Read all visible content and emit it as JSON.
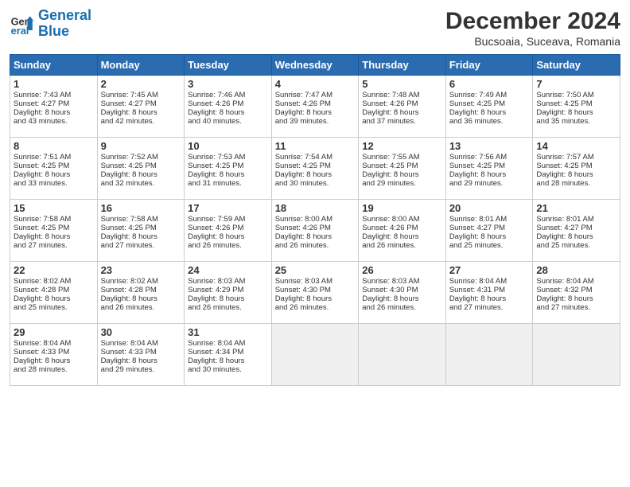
{
  "header": {
    "logo_line1": "General",
    "logo_line2": "Blue",
    "month": "December 2024",
    "location": "Bucsoaia, Suceava, Romania"
  },
  "days_of_week": [
    "Sunday",
    "Monday",
    "Tuesday",
    "Wednesday",
    "Thursday",
    "Friday",
    "Saturday"
  ],
  "weeks": [
    [
      {
        "num": "1",
        "lines": [
          "Sunrise: 7:43 AM",
          "Sunset: 4:27 PM",
          "Daylight: 8 hours",
          "and 43 minutes."
        ]
      },
      {
        "num": "2",
        "lines": [
          "Sunrise: 7:45 AM",
          "Sunset: 4:27 PM",
          "Daylight: 8 hours",
          "and 42 minutes."
        ]
      },
      {
        "num": "3",
        "lines": [
          "Sunrise: 7:46 AM",
          "Sunset: 4:26 PM",
          "Daylight: 8 hours",
          "and 40 minutes."
        ]
      },
      {
        "num": "4",
        "lines": [
          "Sunrise: 7:47 AM",
          "Sunset: 4:26 PM",
          "Daylight: 8 hours",
          "and 39 minutes."
        ]
      },
      {
        "num": "5",
        "lines": [
          "Sunrise: 7:48 AM",
          "Sunset: 4:26 PM",
          "Daylight: 8 hours",
          "and 37 minutes."
        ]
      },
      {
        "num": "6",
        "lines": [
          "Sunrise: 7:49 AM",
          "Sunset: 4:25 PM",
          "Daylight: 8 hours",
          "and 36 minutes."
        ]
      },
      {
        "num": "7",
        "lines": [
          "Sunrise: 7:50 AM",
          "Sunset: 4:25 PM",
          "Daylight: 8 hours",
          "and 35 minutes."
        ]
      }
    ],
    [
      {
        "num": "8",
        "lines": [
          "Sunrise: 7:51 AM",
          "Sunset: 4:25 PM",
          "Daylight: 8 hours",
          "and 33 minutes."
        ]
      },
      {
        "num": "9",
        "lines": [
          "Sunrise: 7:52 AM",
          "Sunset: 4:25 PM",
          "Daylight: 8 hours",
          "and 32 minutes."
        ]
      },
      {
        "num": "10",
        "lines": [
          "Sunrise: 7:53 AM",
          "Sunset: 4:25 PM",
          "Daylight: 8 hours",
          "and 31 minutes."
        ]
      },
      {
        "num": "11",
        "lines": [
          "Sunrise: 7:54 AM",
          "Sunset: 4:25 PM",
          "Daylight: 8 hours",
          "and 30 minutes."
        ]
      },
      {
        "num": "12",
        "lines": [
          "Sunrise: 7:55 AM",
          "Sunset: 4:25 PM",
          "Daylight: 8 hours",
          "and 29 minutes."
        ]
      },
      {
        "num": "13",
        "lines": [
          "Sunrise: 7:56 AM",
          "Sunset: 4:25 PM",
          "Daylight: 8 hours",
          "and 29 minutes."
        ]
      },
      {
        "num": "14",
        "lines": [
          "Sunrise: 7:57 AM",
          "Sunset: 4:25 PM",
          "Daylight: 8 hours",
          "and 28 minutes."
        ]
      }
    ],
    [
      {
        "num": "15",
        "lines": [
          "Sunrise: 7:58 AM",
          "Sunset: 4:25 PM",
          "Daylight: 8 hours",
          "and 27 minutes."
        ]
      },
      {
        "num": "16",
        "lines": [
          "Sunrise: 7:58 AM",
          "Sunset: 4:25 PM",
          "Daylight: 8 hours",
          "and 27 minutes."
        ]
      },
      {
        "num": "17",
        "lines": [
          "Sunrise: 7:59 AM",
          "Sunset: 4:26 PM",
          "Daylight: 8 hours",
          "and 26 minutes."
        ]
      },
      {
        "num": "18",
        "lines": [
          "Sunrise: 8:00 AM",
          "Sunset: 4:26 PM",
          "Daylight: 8 hours",
          "and 26 minutes."
        ]
      },
      {
        "num": "19",
        "lines": [
          "Sunrise: 8:00 AM",
          "Sunset: 4:26 PM",
          "Daylight: 8 hours",
          "and 26 minutes."
        ]
      },
      {
        "num": "20",
        "lines": [
          "Sunrise: 8:01 AM",
          "Sunset: 4:27 PM",
          "Daylight: 8 hours",
          "and 25 minutes."
        ]
      },
      {
        "num": "21",
        "lines": [
          "Sunrise: 8:01 AM",
          "Sunset: 4:27 PM",
          "Daylight: 8 hours",
          "and 25 minutes."
        ]
      }
    ],
    [
      {
        "num": "22",
        "lines": [
          "Sunrise: 8:02 AM",
          "Sunset: 4:28 PM",
          "Daylight: 8 hours",
          "and 25 minutes."
        ]
      },
      {
        "num": "23",
        "lines": [
          "Sunrise: 8:02 AM",
          "Sunset: 4:28 PM",
          "Daylight: 8 hours",
          "and 26 minutes."
        ]
      },
      {
        "num": "24",
        "lines": [
          "Sunrise: 8:03 AM",
          "Sunset: 4:29 PM",
          "Daylight: 8 hours",
          "and 26 minutes."
        ]
      },
      {
        "num": "25",
        "lines": [
          "Sunrise: 8:03 AM",
          "Sunset: 4:30 PM",
          "Daylight: 8 hours",
          "and 26 minutes."
        ]
      },
      {
        "num": "26",
        "lines": [
          "Sunrise: 8:03 AM",
          "Sunset: 4:30 PM",
          "Daylight: 8 hours",
          "and 26 minutes."
        ]
      },
      {
        "num": "27",
        "lines": [
          "Sunrise: 8:04 AM",
          "Sunset: 4:31 PM",
          "Daylight: 8 hours",
          "and 27 minutes."
        ]
      },
      {
        "num": "28",
        "lines": [
          "Sunrise: 8:04 AM",
          "Sunset: 4:32 PM",
          "Daylight: 8 hours",
          "and 27 minutes."
        ]
      }
    ],
    [
      {
        "num": "29",
        "lines": [
          "Sunrise: 8:04 AM",
          "Sunset: 4:33 PM",
          "Daylight: 8 hours",
          "and 28 minutes."
        ]
      },
      {
        "num": "30",
        "lines": [
          "Sunrise: 8:04 AM",
          "Sunset: 4:33 PM",
          "Daylight: 8 hours",
          "and 29 minutes."
        ]
      },
      {
        "num": "31",
        "lines": [
          "Sunrise: 8:04 AM",
          "Sunset: 4:34 PM",
          "Daylight: 8 hours",
          "and 30 minutes."
        ]
      },
      null,
      null,
      null,
      null
    ]
  ]
}
